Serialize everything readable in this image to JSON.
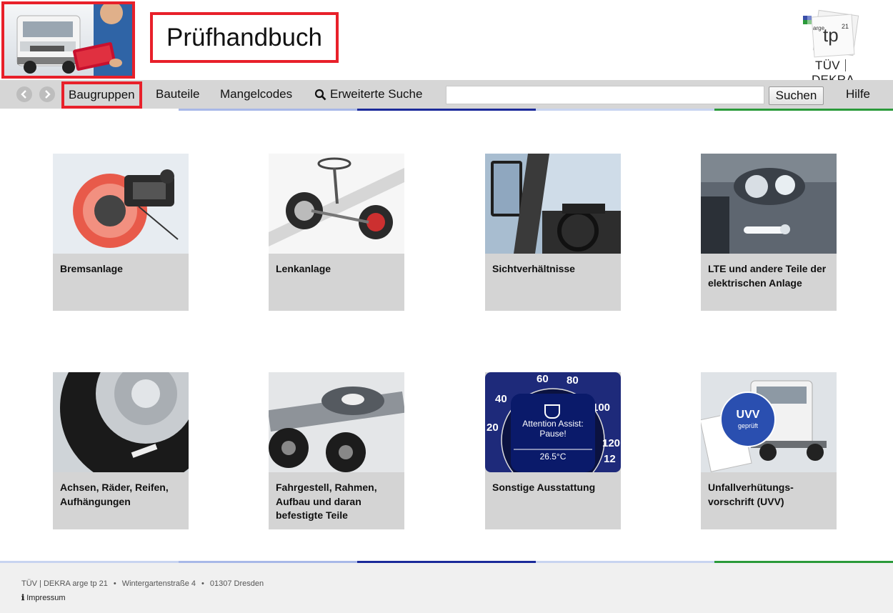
{
  "header": {
    "title": "Prüfhandbuch",
    "brand_arge": "arge",
    "brand_tp": "tp",
    "brand_sup": "21",
    "brand_tuv": "TÜV",
    "brand_dekra": "DEKRA"
  },
  "nav": {
    "back_icon": "back-arrow-icon",
    "forward_icon": "forward-arrow-icon",
    "items": [
      "Baugruppen",
      "Bauteile",
      "Mangelcodes"
    ],
    "advanced_search": "Erweiterte Suche",
    "search_placeholder": "",
    "search_button": "Suchen",
    "help": "Hilfe"
  },
  "colors": {
    "highlight": "#e8202a",
    "nav_bg": "#d6d6d6",
    "tile_bg": "#d4d4d4",
    "strip_light_blue": "#a8b8e8",
    "strip_dark_blue": "#1b2a9a",
    "strip_pale_blue": "#c8d4f0",
    "strip_green": "#2a9a3a"
  },
  "tiles": [
    {
      "label": "Bremsanlage",
      "image": "brake-image"
    },
    {
      "label": "Lenkanlage",
      "image": "steering-image"
    },
    {
      "label": "Sichtverhältnisse",
      "image": "mirror-dashboard-image"
    },
    {
      "label": "LTE und andere Teile der elektrischen Anlage",
      "image": "headlight-image"
    },
    {
      "label": "Achsen, Räder, Reifen, Aufhängungen",
      "image": "wheel-image"
    },
    {
      "label": "Fahrgestell, Rahmen, Aufbau und daran befestigte Teile",
      "image": "fifth-wheel-image"
    },
    {
      "label": "Sonstige Ausstattung",
      "image": "speedometer-image"
    },
    {
      "label": "Unfallverhütungs-vorschrift (UVV)",
      "image": "uvv-truck-image"
    }
  ],
  "gauge": {
    "ticks": [
      "60",
      "80",
      "40",
      "100",
      "20",
      "120",
      "12"
    ],
    "line1": "Attention Assist:",
    "line2": "Pause!",
    "temp": "26.5°C"
  },
  "uvv_badge": {
    "line1": "UVV",
    "line2": "geprüft"
  },
  "footer": {
    "org": "TÜV | DEKRA arge tp 21",
    "street": "Wintergartenstraße 4",
    "city": "01307 Dresden",
    "impressum": "Impressum"
  }
}
